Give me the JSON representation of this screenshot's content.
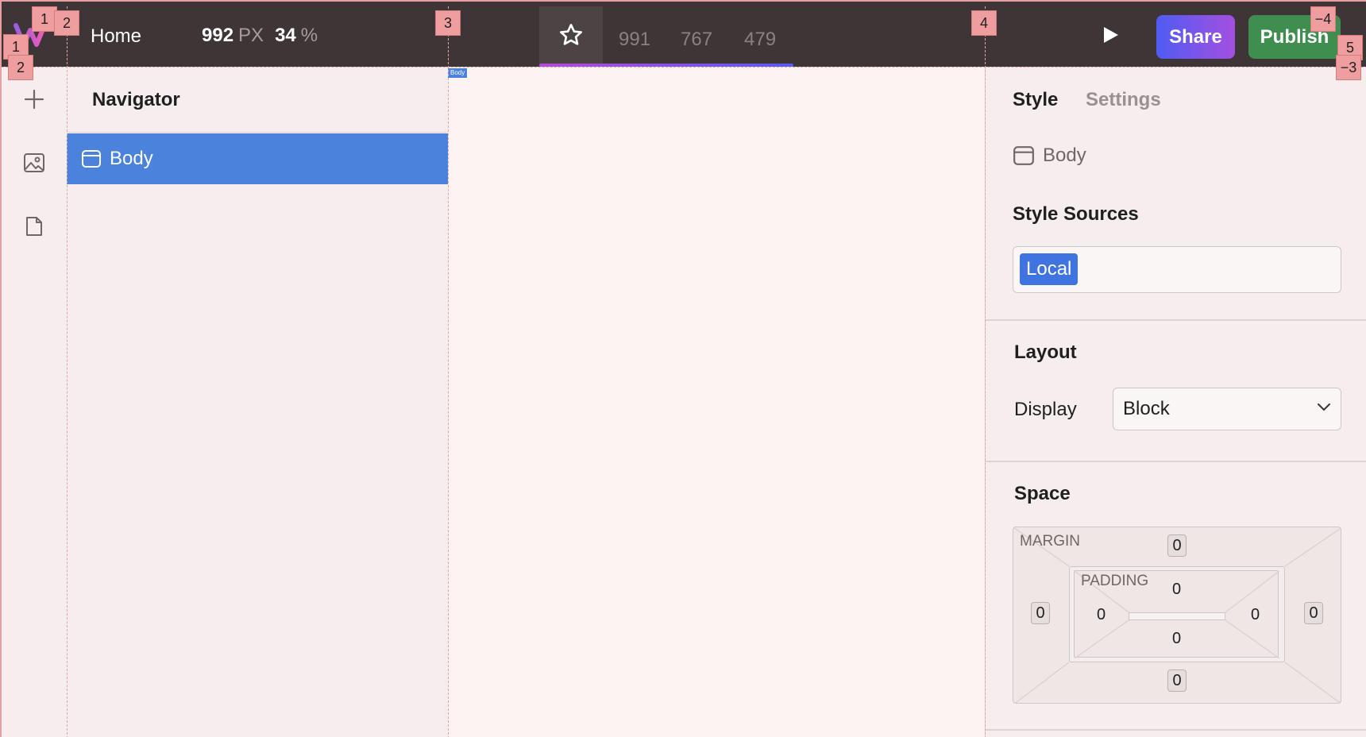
{
  "topbar": {
    "page_name": "Home",
    "width_value": "992",
    "width_unit": "PX",
    "zoom_value": "34",
    "zoom_unit": "%",
    "breakpoints": [
      "991",
      "767",
      "479"
    ],
    "share_label": "Share",
    "publish_label": "Publish"
  },
  "left_rail": {
    "icons": [
      "plus-icon",
      "image-icon",
      "page-icon"
    ]
  },
  "navigator": {
    "title": "Navigator",
    "items": [
      {
        "label": "Body",
        "selected": true
      }
    ]
  },
  "canvas": {
    "selected_tag": "Body"
  },
  "style_panel": {
    "tabs": [
      {
        "label": "Style",
        "active": true
      },
      {
        "label": "Settings",
        "active": false
      }
    ],
    "selected_element": "Body",
    "style_sources_title": "Style Sources",
    "style_source_chip": "Local",
    "layout_title": "Layout",
    "display_label": "Display",
    "display_value": "Block",
    "space_title": "Space",
    "margin_label": "MARGIN",
    "padding_label": "PADDING",
    "margin": {
      "top": "0",
      "right": "0",
      "bottom": "0",
      "left": "0"
    },
    "padding": {
      "top": "0",
      "right": "0",
      "bottom": "0",
      "left": "0"
    }
  },
  "guide_markers": [
    "1",
    "2",
    "3",
    "4",
    "−4",
    "1",
    "2",
    "5",
    "−3"
  ],
  "colors": {
    "topbar_bg": "#3e3536",
    "selection_blue": "#4a82dc",
    "share_gradient_start": "#4f5cf2",
    "share_gradient_end": "#a44fe0",
    "publish_green": "#3f8d4f",
    "guide_pink": "#ee9e9e"
  }
}
